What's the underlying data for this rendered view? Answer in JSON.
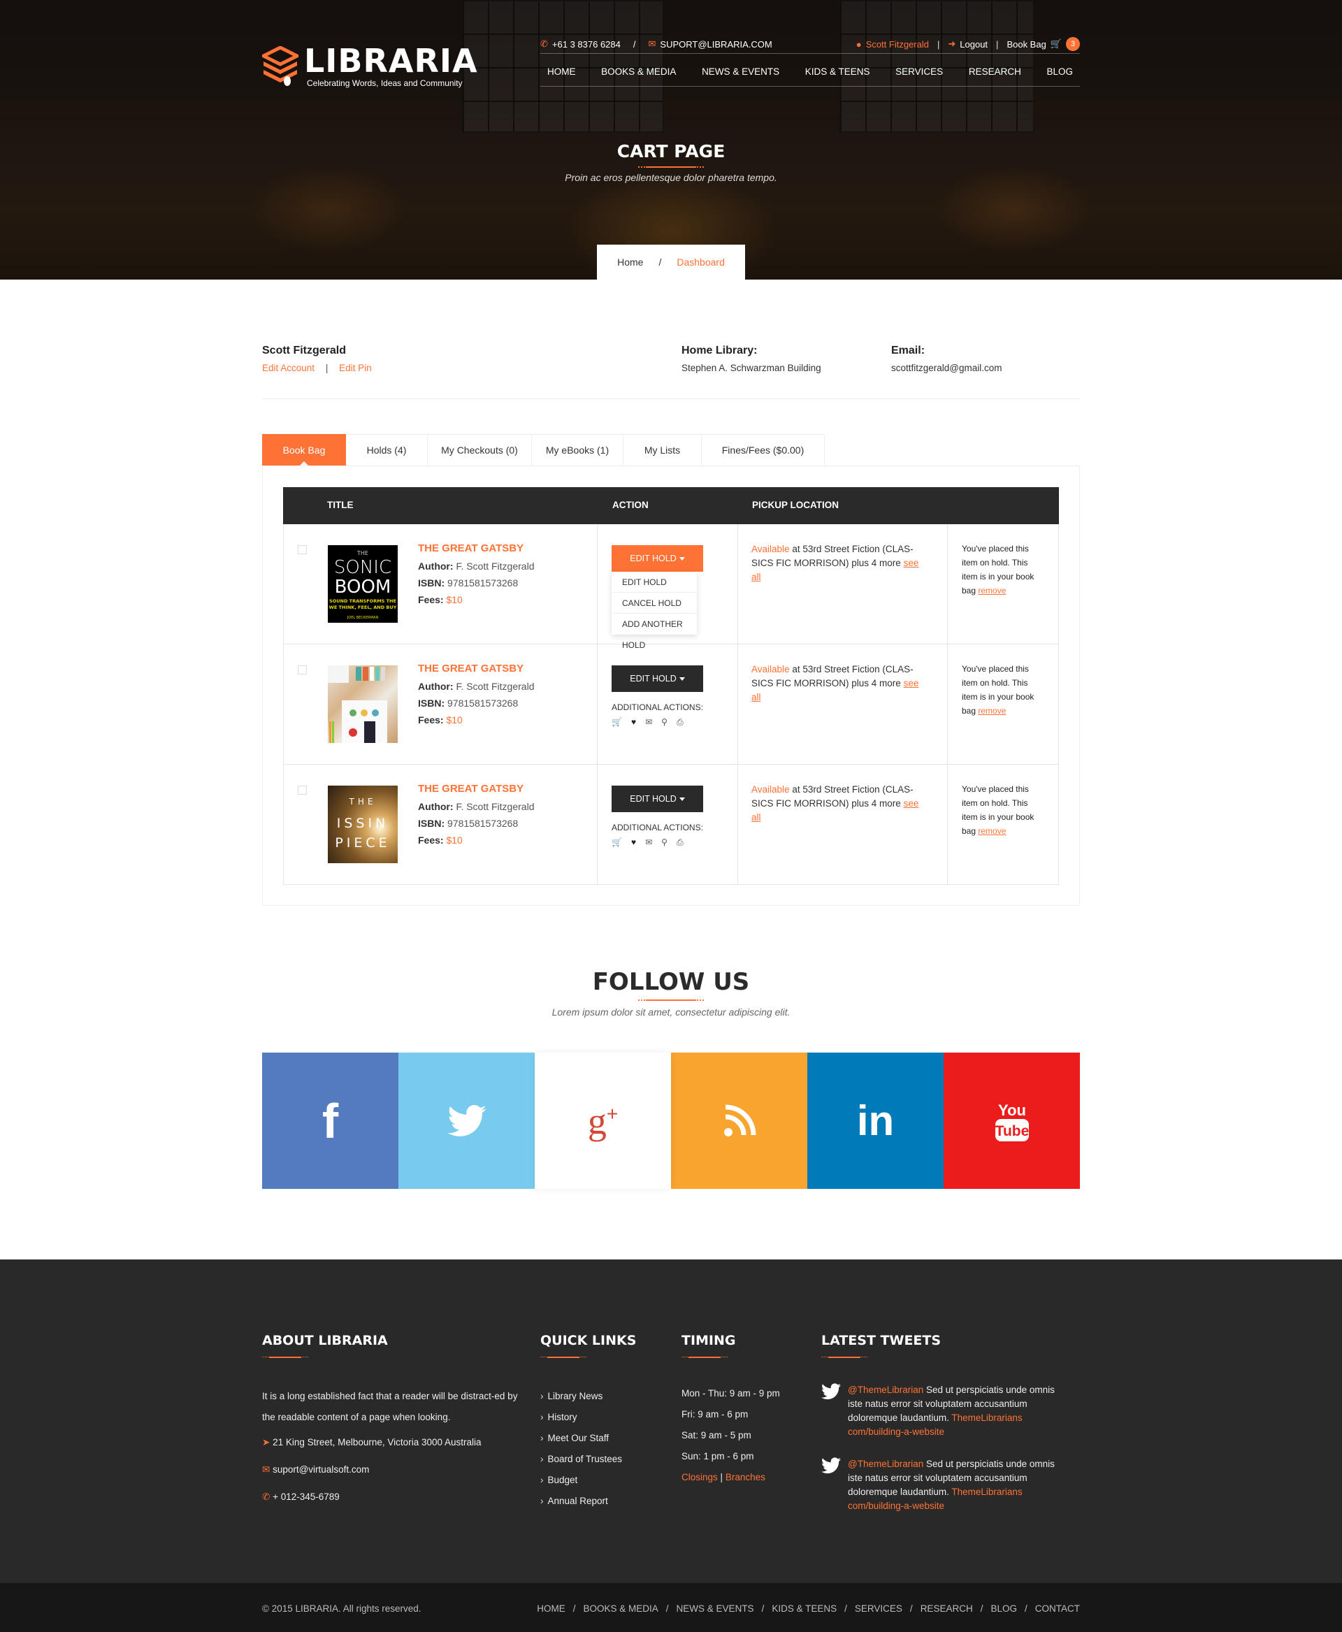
{
  "brand": {
    "name": "LIBRARIA",
    "tagline": "Celebrating Words, Ideas and Community",
    "accent_color": "#ff7236"
  },
  "topbar": {
    "phone": "+61 3 8376 6284",
    "separator": "/",
    "email": "SUPORT@LIBRARIA.COM",
    "user": "Scott Fitzgerald",
    "logout": "Logout",
    "book_bag": "Book Bag",
    "bag_count": "3",
    "pipe": "|"
  },
  "nav": [
    "HOME",
    "BOOKS & MEDIA",
    "NEWS & EVENTS",
    "KIDS & TEENS",
    "SERVICES",
    "RESEARCH",
    "BLOG"
  ],
  "hero": {
    "title": "CART PAGE",
    "subtitle": "Proin ac eros pellentesque dolor pharetra tempo."
  },
  "breadcrumb": {
    "home": "Home",
    "separator": "/",
    "current": "Dashboard"
  },
  "account": {
    "name": "Scott Fitzgerald",
    "edit_account": "Edit Account",
    "separator": "|",
    "edit_pin": "Edit Pin",
    "home_library_label": "Home Library:",
    "home_library": "Stephen A. Schwarzman Building",
    "email_label": "Email:",
    "email": "scottfitzgerald@gmail.com"
  },
  "tabs": [
    {
      "label": "Book Bag",
      "active": true
    },
    {
      "label": "Holds (4)",
      "active": false
    },
    {
      "label": "My Checkouts (0)",
      "active": false
    },
    {
      "label": "My eBooks (1)",
      "active": false
    },
    {
      "label": "My Lists",
      "active": false
    },
    {
      "label": "Fines/Fees ($0.00)",
      "active": false
    }
  ],
  "table": {
    "headers": {
      "title": "TITLE",
      "action": "ACTION",
      "pickup": "PICKUP LOCATION"
    },
    "labels": {
      "author": "Author:",
      "isbn": "ISBN:",
      "fees": "Fees:",
      "edit_hold": "EDIT HOLD",
      "additional_actions": "ADDITIONAL ACTIONS:",
      "available": "Available",
      "see_all": "see all",
      "remove": "remove"
    },
    "rows": [
      {
        "cover": "The Sonic Boom",
        "title": "THE GREAT GATSBY",
        "author": "F. Scott Fitzgerald",
        "isbn": "9781581573268",
        "fees": "$10",
        "dropdown_open": true,
        "pickup_text": "at 53rd Street Fiction (CLAS-SICS FIC MORRISON) plus 4 more",
        "note": "You've placed this item on hold. This item is in your book bag"
      },
      {
        "cover": "Desk workspace",
        "title": "THE GREAT GATSBY",
        "author": "F. Scott Fitzgerald",
        "isbn": "9781581573268",
        "fees": "$10",
        "dropdown_open": false,
        "pickup_text": "at 53rd Street Fiction (CLAS-SICS FIC MORRISON) plus 4 more",
        "note": "You've placed this item on hold. This item is in your book bag"
      },
      {
        "cover": "The Missing Piece",
        "title": "THE GREAT GATSBY",
        "author": "F. Scott Fitzgerald",
        "isbn": "9781581573268",
        "fees": "$10",
        "dropdown_open": false,
        "pickup_text": "at 53rd Street Fiction (CLAS-SICS FIC MORRISON) plus 4 more",
        "note": "You've placed this item on hold. This item is in your book bag"
      }
    ],
    "dropdown_items": [
      "EDIT HOLD",
      "CANCEL HOLD",
      "ADD ANOTHER HOLD"
    ],
    "action_icons": [
      "cart-icon",
      "heart-icon",
      "envelope-icon",
      "search-icon",
      "print-icon"
    ]
  },
  "follow": {
    "title": "FOLLOW US",
    "subtitle": "Lorem ipsum dolor sit amet, consectetur adipiscing elit.",
    "networks": [
      {
        "name": "facebook",
        "color": "#537bbd"
      },
      {
        "name": "twitter",
        "color": "#78cbef"
      },
      {
        "name": "google-plus",
        "color": "#ffffff"
      },
      {
        "name": "rss",
        "color": "#f8a42f"
      },
      {
        "name": "linkedin",
        "color": "#007ab9"
      },
      {
        "name": "youtube",
        "color": "#ed1c1c"
      }
    ]
  },
  "footer": {
    "about": {
      "title": "ABOUT LIBRARIA",
      "text": "It is a long established fact that a reader will be distract-ed by the readable content of a page when looking.",
      "address": "21 King Street, Melbourne, Victoria 3000 Australia",
      "email": "suport@virtualsoft.com",
      "phone": "+ 012-345-6789"
    },
    "quick_links": {
      "title": "QUICK LINKS",
      "items": [
        "Library News",
        "History",
        "Meet Our Staff",
        "Board of Trustees",
        "Budget",
        "Annual Report"
      ]
    },
    "timing": {
      "title": "TIMING",
      "items": [
        "Mon - Thu: 9 am - 9 pm",
        "Fri: 9 am - 6 pm",
        "Sat: 9 am - 5 pm",
        "Sun: 1 pm - 6 pm"
      ],
      "closings": "Closings",
      "separator": "|",
      "branches": "Branches"
    },
    "tweets": {
      "title": "LATEST TWEETS",
      "items": [
        {
          "handle": "@ThemeLibrarian",
          "text": "Sed ut perspiciatis unde omnis iste natus error sit voluptatem accusantium doloremque laudantium.",
          "link": "ThemeLibrarians com/building-a-website"
        },
        {
          "handle": "@ThemeLibrarian",
          "text": "Sed ut perspiciatis unde omnis iste natus error sit voluptatem accusantium doloremque laudantium.",
          "link": "ThemeLibrarians com/building-a-website"
        }
      ]
    }
  },
  "bottom": {
    "copyright": "© 2015 LIBRARIA. All rights reserved.",
    "nav": [
      "HOME",
      "BOOKS & MEDIA",
      "NEWS & EVENTS",
      "KIDS & TEENS",
      "SERVICES",
      "RESEARCH",
      "BLOG",
      "CONTACT"
    ],
    "separator": "/"
  }
}
